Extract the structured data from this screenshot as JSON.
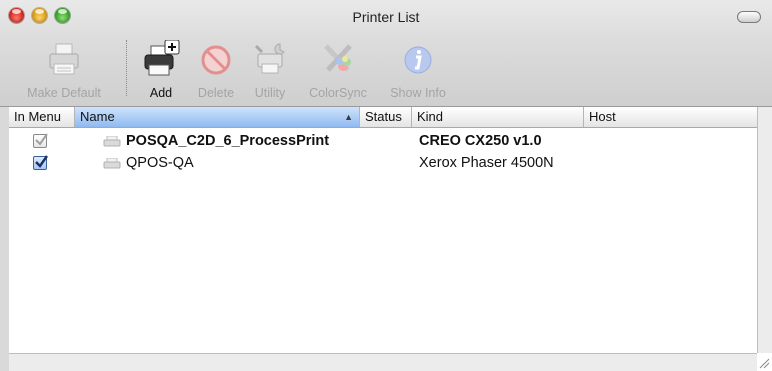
{
  "window": {
    "title": "Printer List"
  },
  "toolbar": {
    "items": [
      {
        "label": "Make Default",
        "icon": "printer-icon",
        "enabled": false
      },
      {
        "label": "Add",
        "icon": "add-printer-icon",
        "enabled": true
      },
      {
        "label": "Delete",
        "icon": "delete-icon",
        "enabled": false
      },
      {
        "label": "Utility",
        "icon": "utility-icon",
        "enabled": false
      },
      {
        "label": "ColorSync",
        "icon": "colorsync-icon",
        "enabled": false
      },
      {
        "label": "Show Info",
        "icon": "info-icon",
        "enabled": false
      }
    ]
  },
  "table": {
    "columns": [
      "In Menu",
      "Name",
      "Status",
      "Kind",
      "Host"
    ],
    "sorted_column": "Name",
    "sort_direction": "ascending",
    "rows": [
      {
        "in_menu": true,
        "in_menu_enabled": false,
        "name": "POSQA_C2D_6_ProcessPrint",
        "status": "",
        "kind": "CREO CX250 v1.0",
        "host": "",
        "is_default": true
      },
      {
        "in_menu": true,
        "in_menu_enabled": true,
        "name": "QPOS-QA",
        "status": "",
        "kind": "Xerox Phaser 4500N",
        "host": "",
        "is_default": false
      }
    ]
  },
  "colors": {
    "sort_header": "#8fbaf0",
    "checkbox_accent": "#2a3f7a"
  }
}
